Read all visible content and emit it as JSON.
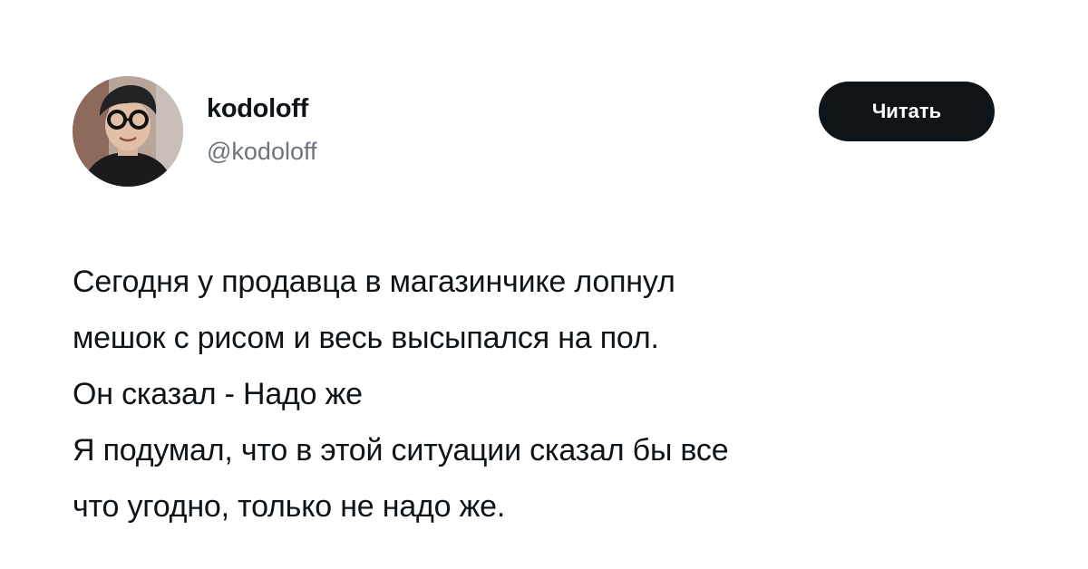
{
  "author": {
    "display_name": "kodoloff",
    "handle": "@kodoloff",
    "avatar_icon": "user-avatar-photo"
  },
  "actions": {
    "follow_label": "Читать"
  },
  "tweet": {
    "lines": [
      "Сегодня у продавца в магазинчике лопнул",
      "мешок с рисом и весь высыпался на пол.",
      "Он сказал - Надо же",
      "Я подумал, что в этой ситуации сказал бы все",
      "что угодно, только не надо же."
    ]
  },
  "colors": {
    "background": "#ffffff",
    "text": "#0f1419",
    "secondary_text": "#6b7480",
    "button_bg": "#0f1419",
    "button_text": "#ffffff"
  }
}
